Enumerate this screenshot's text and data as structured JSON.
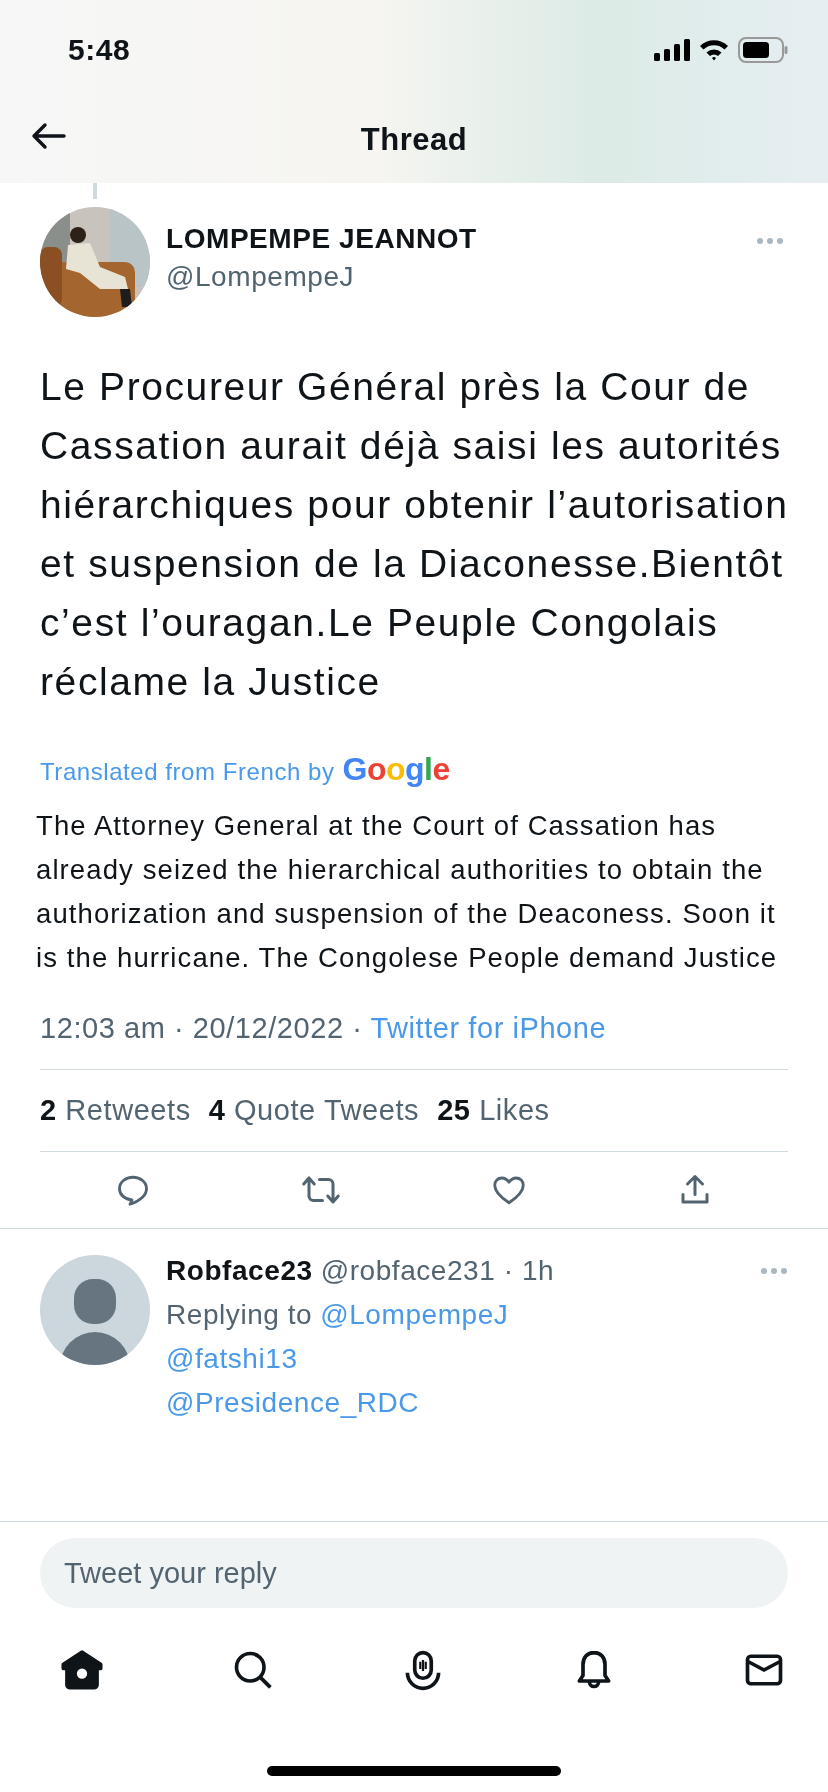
{
  "status_bar": {
    "time": "5:48"
  },
  "header": {
    "title": "Thread"
  },
  "tweet": {
    "author": {
      "name": "LOMPEMPE JEANNOT",
      "handle": "@LompempeJ"
    },
    "text": "Le Procureur Général près la Cour de Cassation aurait déjà saisi les autorités hiérarchiques pour obtenir l’autorisation et suspension de la Diaconesse.Bientôt c’est l’ouragan.Le Peuple Congolais réclame la Justice",
    "translation": {
      "label": "Translated from French by",
      "brand": "Google",
      "text": "The Attorney General at the Court of Cassation has already seized the hierarchical authorities to obtain the authorization and suspension of the Deaconess. Soon it is the hurricane. The Congolese People demand Justice"
    },
    "meta": {
      "timestamp": "12:03 am · 20/12/2022 ·",
      "source": "Twitter for iPhone"
    },
    "stats": [
      {
        "count": "2",
        "label": "Retweets"
      },
      {
        "count": "4",
        "label": "Quote Tweets"
      },
      {
        "count": "25",
        "label": "Likes"
      }
    ],
    "actions": [
      {
        "kind": "reply"
      },
      {
        "kind": "retweet"
      },
      {
        "kind": "like"
      },
      {
        "kind": "share"
      }
    ]
  },
  "reply": {
    "name": "Robface23",
    "handle": "@robface231 · 1h",
    "replying_label": "Replying to",
    "replying_to": "@LompempeJ",
    "mentions": [
      "@fatshi13",
      "@Presidence_RDC"
    ]
  },
  "composer": {
    "placeholder": "Tweet your reply"
  },
  "tab_bar": [
    {
      "kind": "home",
      "selected": true
    },
    {
      "kind": "search",
      "selected": false
    },
    {
      "kind": "spaces",
      "selected": false
    },
    {
      "kind": "notifications",
      "selected": false
    },
    {
      "kind": "messages",
      "selected": false
    }
  ]
}
